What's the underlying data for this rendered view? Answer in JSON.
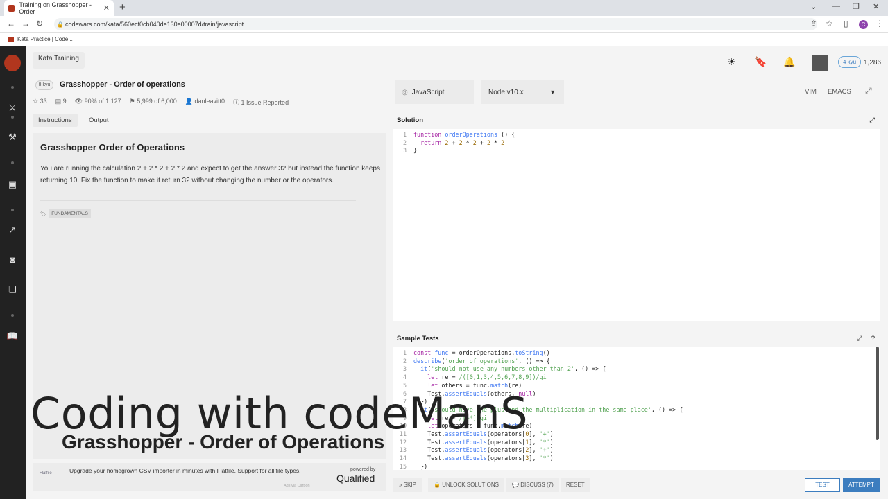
{
  "browser": {
    "tab_title": "Training on Grasshopper - Order",
    "url": "codewars.com/kata/560ecf0cb040de130e00007d/train/javascript",
    "bookmark": "Kata Practice | Code..."
  },
  "header": {
    "kata_training_label": "Kata Training",
    "kyu_badge": "4 kyu",
    "honor": "1,286"
  },
  "kata": {
    "rank": "8 kyu",
    "title": "Grasshopper - Order of operations",
    "stats": {
      "stars": "33",
      "collections": "9",
      "satisfaction": "90% of 1,127",
      "completed": "5,999 of 6,000",
      "author": "danleavitt0",
      "issues": "1 Issue Reported"
    },
    "tabs": [
      "Instructions",
      "Output"
    ],
    "instructions_title": "Grasshopper Order of Operations",
    "instructions_text": "You are running the calculation 2 + 2 * 2 + 2 * 2 and expect to get the answer 32 but instead the function keeps returning 10. Fix the function to make it return 32 without changing the number or the operators.",
    "tag": "FUNDAMENTALS"
  },
  "ad": {
    "brand": "Flatfile",
    "text": "Upgrade your homegrown CSV importer in minutes with Flatfile. Support for all file types.",
    "powered_by": "powered by",
    "qualified": "Qualified",
    "via": "Ads via Carbon"
  },
  "overlay": {
    "title": "Coding with codeManS",
    "subtitle": "Grasshopper - Order of Operations"
  },
  "editor": {
    "language": "JavaScript",
    "node_version": "Node v10.x",
    "vim": "VIM",
    "emacs": "EMACS",
    "solution_label": "Solution",
    "sample_tests_label": "Sample Tests"
  },
  "actions": {
    "skip": "SKIP",
    "unlock": "UNLOCK SOLUTIONS",
    "discuss": "DISCUSS (7)",
    "reset": "RESET",
    "test": "TEST",
    "attempt": "ATTEMPT"
  },
  "colors": {
    "brand_red": "#b1361e",
    "accent_blue": "#3c7dbf",
    "sidebar_bg": "#222222"
  }
}
